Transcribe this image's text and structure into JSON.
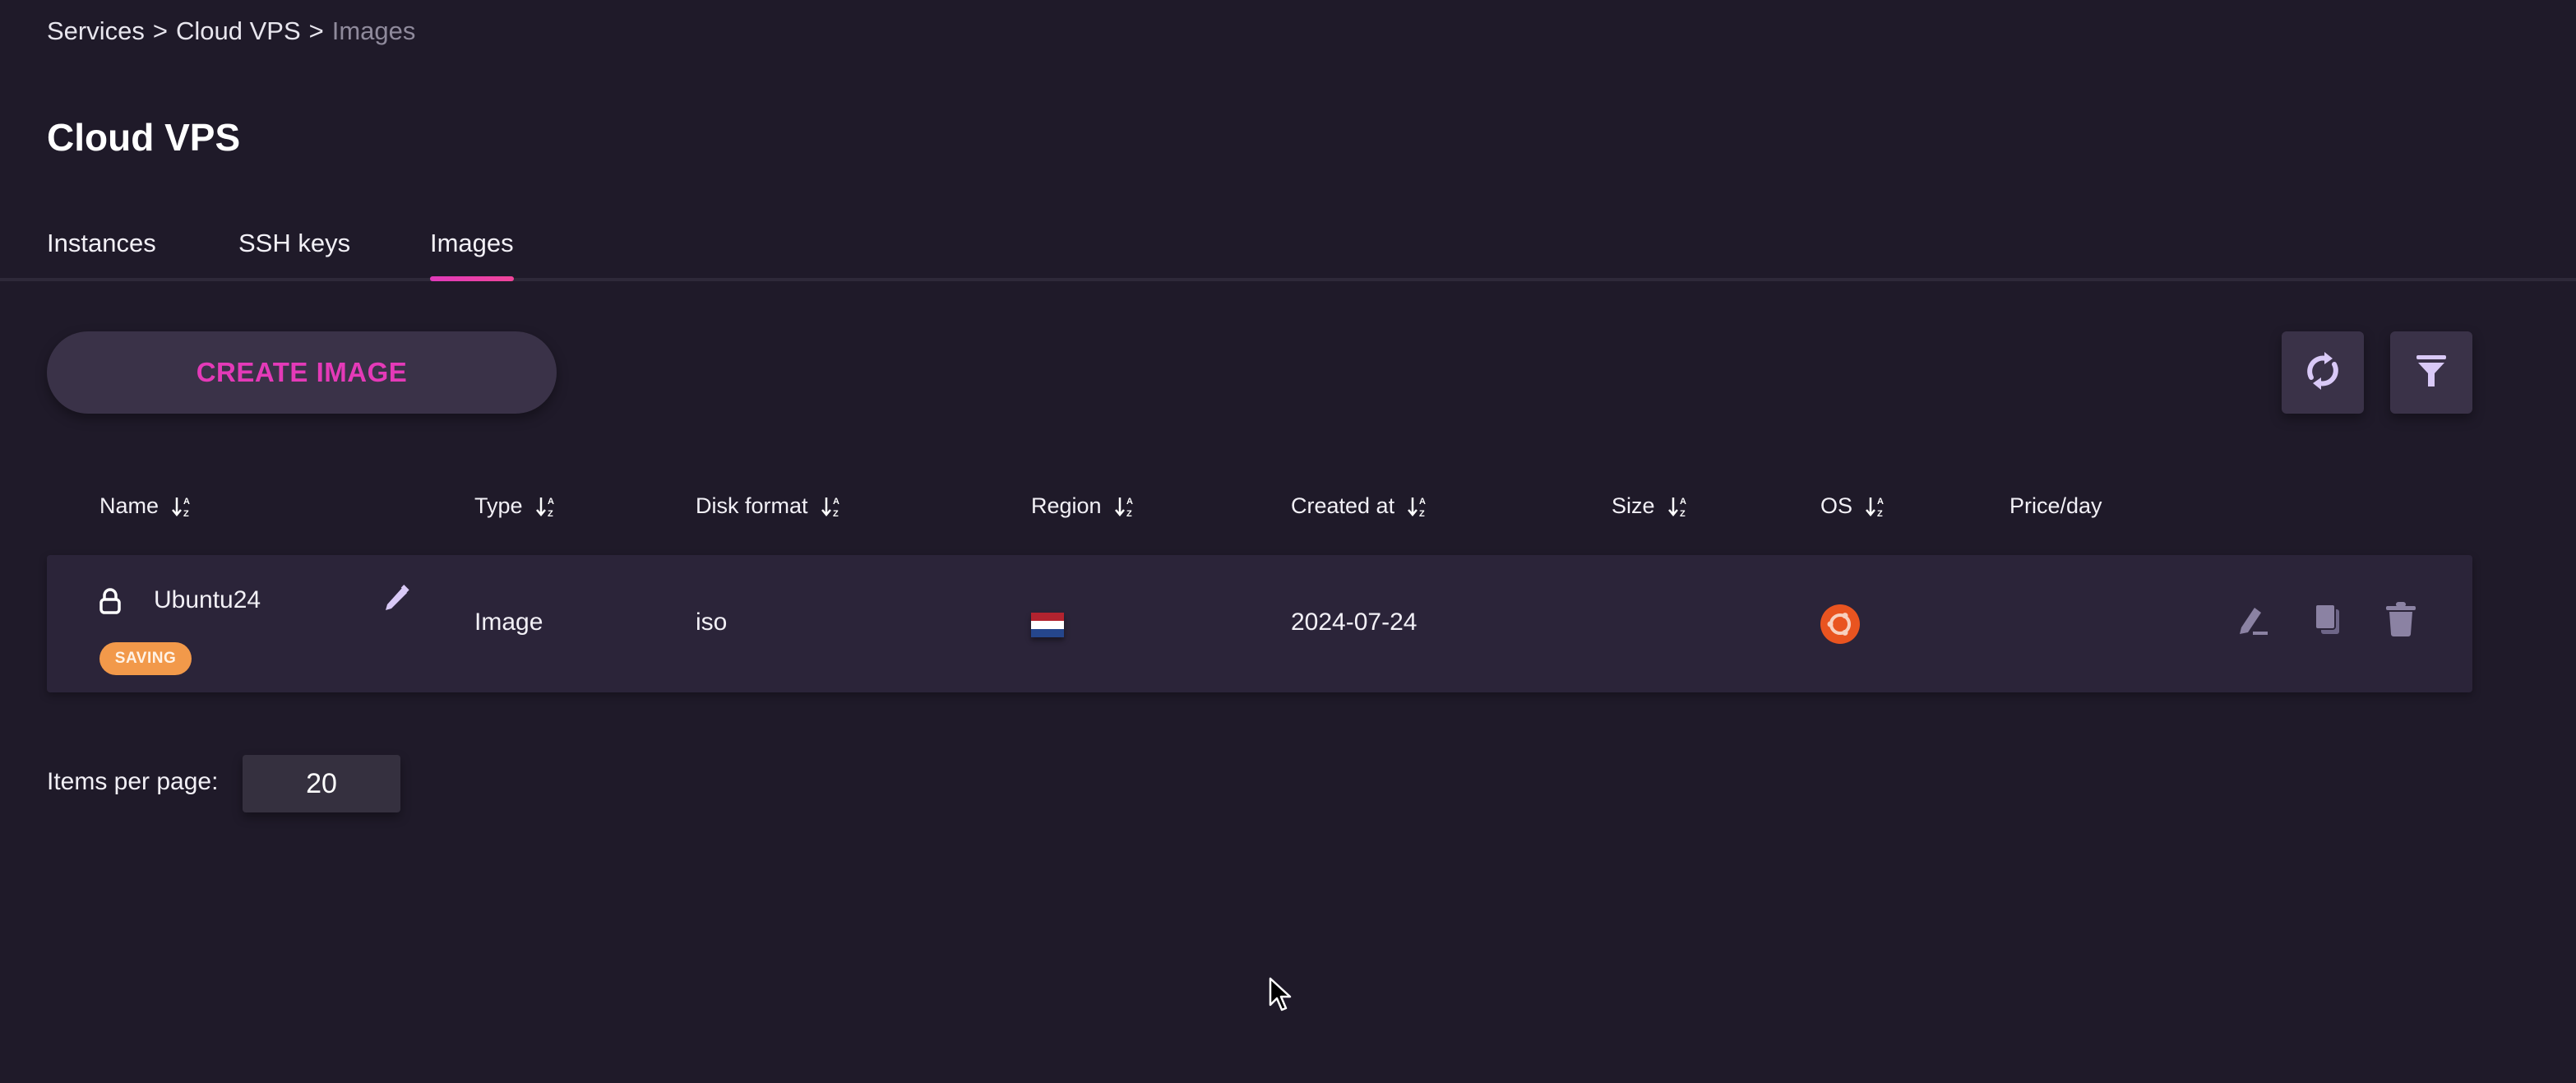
{
  "breadcrumb": {
    "items": [
      "Services",
      "Cloud VPS"
    ],
    "separator": ">",
    "current": "Images"
  },
  "page": {
    "title": "Cloud VPS"
  },
  "tabs": [
    {
      "label": "Instances",
      "active": false
    },
    {
      "label": "SSH keys",
      "active": false
    },
    {
      "label": "Images",
      "active": true
    }
  ],
  "toolbar": {
    "create_label": "CREATE IMAGE",
    "refresh_icon": "refresh-icon",
    "filter_icon": "filter-icon"
  },
  "table": {
    "columns": [
      {
        "label": "Name",
        "sortable": true
      },
      {
        "label": "Type",
        "sortable": true
      },
      {
        "label": "Disk format",
        "sortable": true
      },
      {
        "label": "Region",
        "sortable": true
      },
      {
        "label": "Created at",
        "sortable": true
      },
      {
        "label": "Size",
        "sortable": true
      },
      {
        "label": "OS",
        "sortable": true
      },
      {
        "label": "Price/day",
        "sortable": false
      }
    ],
    "rows": [
      {
        "name": "Ubuntu24",
        "locked": true,
        "status": "SAVING",
        "type": "Image",
        "disk_format": "iso",
        "region": "Netherlands",
        "created_at": "2024-07-24",
        "size": "",
        "os": "Ubuntu",
        "price_per_day": "",
        "actions": [
          "edit-icon",
          "copy-icon",
          "delete-icon"
        ]
      }
    ]
  },
  "pagination": {
    "items_per_page_label": "Items per page:",
    "items_per_page": "20"
  },
  "colors": {
    "background": "#1f1a29",
    "accent": "#e43ab8",
    "row_background": "#2b2439",
    "status_saving": "#f2994a",
    "ubuntu": "#e95420",
    "icon_light": "#d9c9f7",
    "icon_muted": "#8b82a3"
  }
}
